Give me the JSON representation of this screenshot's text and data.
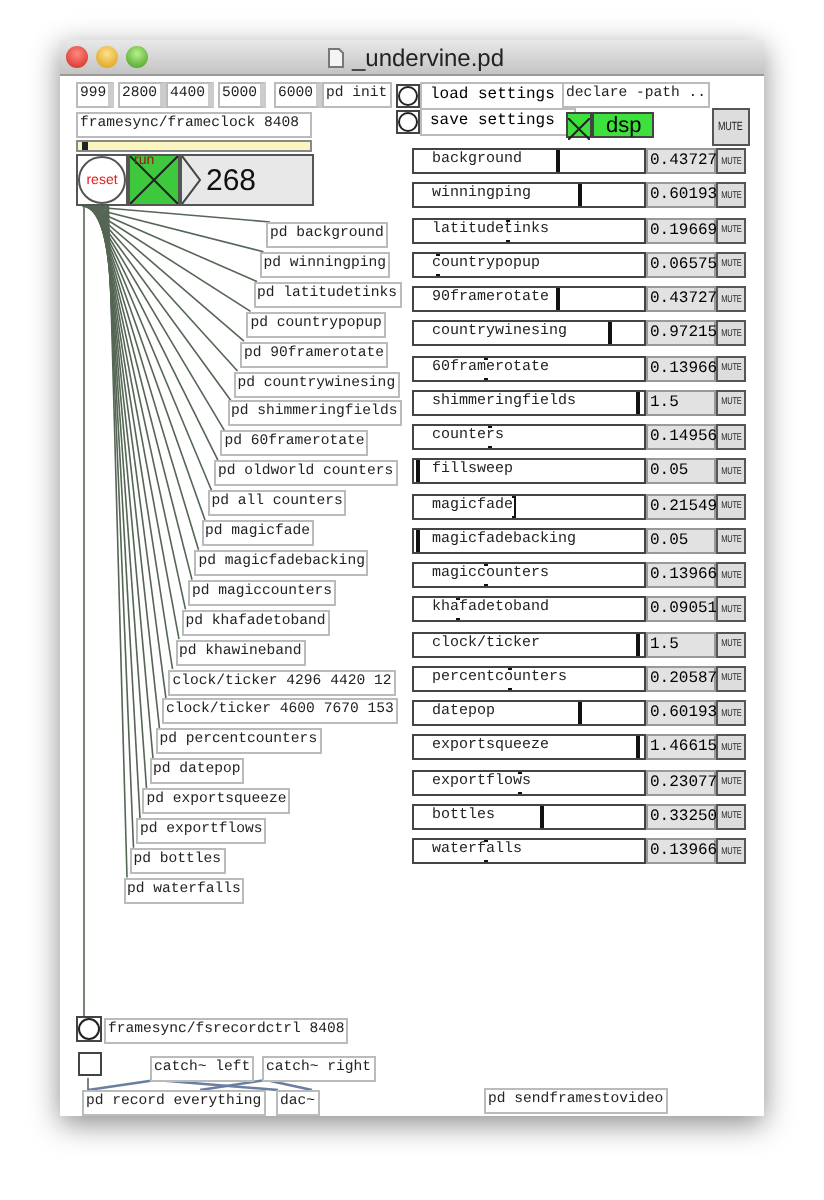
{
  "window": {
    "title": "_undervine.pd"
  },
  "messages": [
    "999",
    "2800",
    "4400",
    "5000",
    "6000"
  ],
  "init": "pd init",
  "settings": [
    "load settings",
    "save settings"
  ],
  "declare": "declare -path ..",
  "dsp": {
    "label": "dsp",
    "on": true
  },
  "master_mute": "MUTE",
  "clock": {
    "object": "framesync/frameclock 8408",
    "level": 0.02,
    "reset": "reset",
    "run": "run",
    "running": true,
    "count": "268"
  },
  "subpatches": [
    "pd background",
    "pd winningping",
    "pd latitudetinks",
    "pd countrypopup",
    "pd 90framerotate",
    "pd countrywinesing",
    "pd shimmeringfields",
    "pd 60framerotate",
    "pd oldworld counters",
    "pd all counters",
    "pd magicfade",
    "pd magicfadebacking",
    "pd magiccounters",
    "pd khafadetoband",
    "pd khawineband",
    "clock/ticker 4296 4420 12",
    "clock/ticker 4600 7670 153",
    "pd percentcounters",
    "pd datepop",
    "pd exportsqueeze",
    "pd exportflows",
    "pd bottles",
    "pd waterfalls"
  ],
  "channels": [
    {
      "name": "background",
      "level": 0.63,
      "reading": "0.43727",
      "mute": "MUTE"
    },
    {
      "name": "winningping",
      "level": 0.73,
      "reading": "0.60193",
      "mute": "MUTE"
    },
    {
      "name": "latitudetinks",
      "level": 0.41,
      "reading": "0.19669",
      "mute": "MUTE"
    },
    {
      "name": "countrypopup",
      "level": 0.1,
      "reading": "0.06575",
      "mute": "MUTE"
    },
    {
      "name": "90framerotate",
      "level": 0.63,
      "reading": "0.43727",
      "mute": "MUTE"
    },
    {
      "name": "countrywinesing",
      "level": 0.86,
      "reading": "0.97215",
      "mute": "MUTE"
    },
    {
      "name": "60framerotate",
      "level": 0.31,
      "reading": "0.13966",
      "mute": "MUTE"
    },
    {
      "name": "shimmeringfields",
      "level": 0.98,
      "reading": "1.5",
      "mute": "MUTE"
    },
    {
      "name": "counters",
      "level": 0.33,
      "reading": "0.14956",
      "mute": "MUTE"
    },
    {
      "name": "fillsweep",
      "level": 0.01,
      "reading": "0.05",
      "mute": "MUTE"
    },
    {
      "name": "magicfade",
      "level": 0.43,
      "reading": "0.21549",
      "mute": "MUTE"
    },
    {
      "name": "magicfadebacking",
      "level": 0.01,
      "reading": "0.05",
      "mute": "MUTE"
    },
    {
      "name": "magiccounters",
      "level": 0.31,
      "reading": "0.13966",
      "mute": "MUTE"
    },
    {
      "name": "khafadetoband",
      "level": 0.19,
      "reading": "0.09051",
      "mute": "MUTE"
    },
    {
      "name": "clock/ticker",
      "level": 0.98,
      "reading": "1.5",
      "mute": "MUTE"
    },
    {
      "name": "percentcounters",
      "level": 0.42,
      "reading": "0.20587",
      "mute": "MUTE"
    },
    {
      "name": "datepop",
      "level": 0.73,
      "reading": "0.60193",
      "mute": "MUTE"
    },
    {
      "name": "exportsqueeze",
      "level": 0.98,
      "reading": "1.46615",
      "mute": "MUTE"
    },
    {
      "name": "exportflows",
      "level": 0.46,
      "reading": "0.23077",
      "mute": "MUTE"
    },
    {
      "name": "bottles",
      "level": 0.56,
      "reading": "0.33250",
      "mute": "MUTE"
    },
    {
      "name": "waterfalls",
      "level": 0.31,
      "reading": "0.13966",
      "mute": "MUTE"
    }
  ],
  "recorder": {
    "object": "framesync/fsrecordctrl 8408",
    "toggle_on": false,
    "catches": [
      "catch~ left",
      "catch~ right"
    ],
    "record": "pd record everything",
    "dac": "dac~",
    "send": "pd sendframestovideo"
  }
}
